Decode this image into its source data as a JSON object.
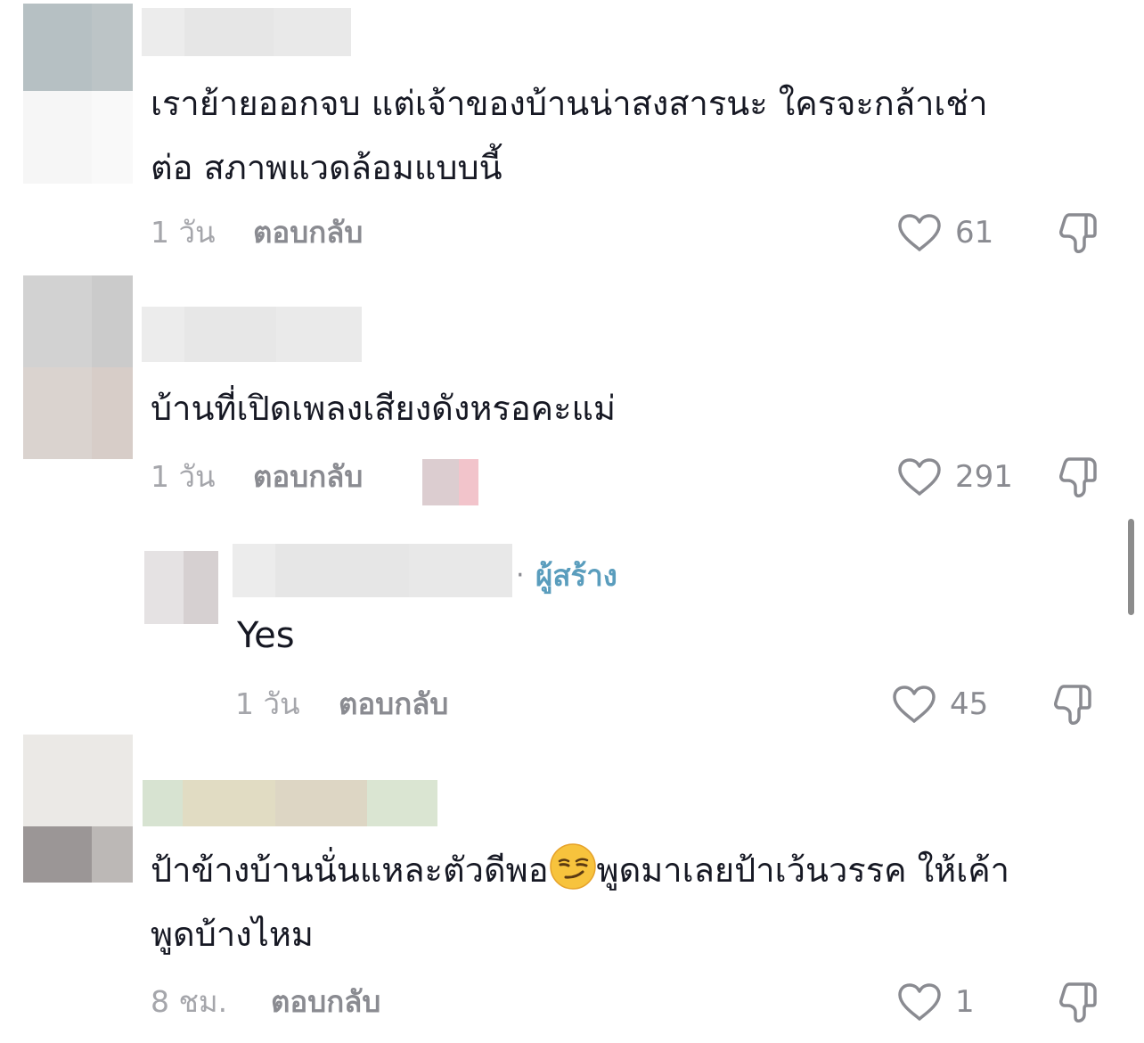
{
  "comments": [
    {
      "text": "เราย้ายออกจบ แต่เจ้าของบ้านน่าสงสารนะ ใครจะกล้าเช่า\nต่อ สภาพแวดล้อมแบบนี้",
      "time": "1 วัน",
      "reply_label": "ตอบกลับ",
      "likes": "61"
    },
    {
      "text": "บ้านที่เปิดเพลงเสียงดังหรอคะแม่",
      "time": "1 วัน",
      "reply_label": "ตอบกลับ",
      "likes": "291",
      "reply": {
        "creator_badge": "ผู้สร้าง",
        "text": "Yes",
        "time": "1 วัน",
        "reply_label": "ตอบกลับ",
        "likes": "45"
      }
    },
    {
      "text_before_emoji": "ป้าข้างบ้านนั่นแหละตัวดีพอ",
      "emoji": "smirking-face",
      "text_after_emoji": "พูดมาเลยป้าเว้นวรรค ให้เค้า\nพูดบ้างไหม",
      "time": "8 ชม.",
      "reply_label": "ตอบกลับ",
      "likes": "1"
    }
  ],
  "colors": {
    "text": "#161823",
    "secondary": "#8a8b91",
    "timestamp": "#a5a6ab",
    "creator": "#5a9dbd"
  }
}
